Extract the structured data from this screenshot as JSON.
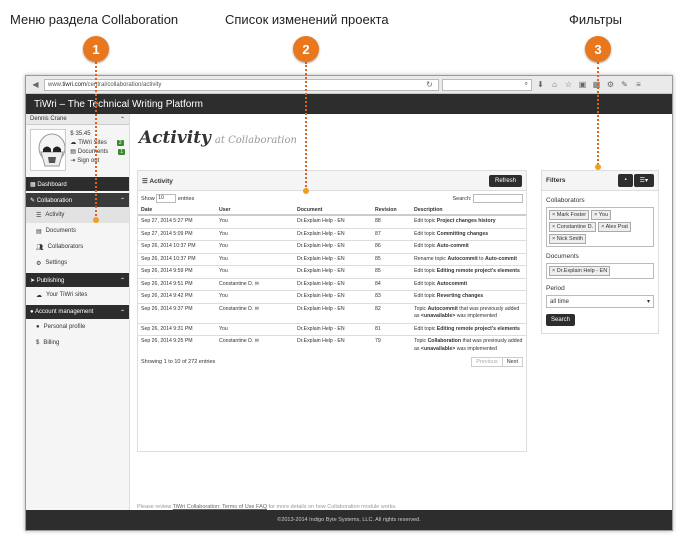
{
  "callouts": [
    {
      "label": "Меню раздела Collaboration",
      "number": "1"
    },
    {
      "label": "Список изменений проекта",
      "number": "2"
    },
    {
      "label": "Фильтры",
      "number": "3"
    }
  ],
  "browser": {
    "url_prefix": "www.",
    "url_domain": "tiwri.com",
    "url_path": "/central/collaboration/activity",
    "search_icon": "search-icon"
  },
  "app": {
    "title": "TiWri  – The Technical Writing Platform"
  },
  "sidebar": {
    "user_name": "Dennis Crane",
    "stats": [
      {
        "icon": "$",
        "label": "35.45",
        "count": ""
      },
      {
        "icon": "☁",
        "label": "TiWri Sites",
        "count": "2"
      },
      {
        "icon": "▤",
        "label": "Documents",
        "count": "1"
      },
      {
        "icon": "⇥",
        "label": "Sign out",
        "count": ""
      }
    ],
    "dashboard": "Dashboard",
    "collaboration": "Collaboration",
    "collab_items": [
      "Activity",
      "Documents",
      "Collaborators",
      "Settings"
    ],
    "publishing": "Publishing",
    "publishing_items": [
      "Your TiWri sites"
    ],
    "account": "Account management",
    "account_items": [
      "Personal profile",
      "Billing"
    ]
  },
  "page": {
    "title": "Activity",
    "subtitle": "at Collaboration"
  },
  "activity": {
    "panel_title": "Activity",
    "refresh": "Refresh",
    "show_label": "Show",
    "show_value": "10",
    "entries_label": "entries",
    "search_label": "Search:",
    "columns": [
      "Date",
      "User",
      "Document",
      "Revision",
      "Description"
    ],
    "rows": [
      {
        "date": "Sep 27, 2014 5:27 PM",
        "user": "You",
        "doc": "Dr.Explain Help - EN",
        "rev": "88",
        "pre": "Edit topic ",
        "bold": "Project changes history",
        "post": "",
        "bold2": "",
        "post2": ""
      },
      {
        "date": "Sep 27, 2014 5:09 PM",
        "user": "You",
        "doc": "Dr.Explain Help - EN",
        "rev": "87",
        "pre": "Edit topic ",
        "bold": "Committing changes",
        "post": "",
        "bold2": "",
        "post2": ""
      },
      {
        "date": "Sep 26, 2014 10:37 PM",
        "user": "You",
        "doc": "Dr.Explain Help - EN",
        "rev": "86",
        "pre": "Edit topic ",
        "bold": "Auto-commit",
        "post": "",
        "bold2": "",
        "post2": ""
      },
      {
        "date": "Sep 26, 2014 10:37 PM",
        "user": "You",
        "doc": "Dr.Explain Help - EN",
        "rev": "85",
        "pre": "Rename topic ",
        "bold": "Autocommit",
        "post": " to ",
        "bold2": "Auto-commit",
        "post2": ""
      },
      {
        "date": "Sep 26, 2014 9:59 PM",
        "user": "You",
        "doc": "Dr.Explain Help - EN",
        "rev": "85",
        "pre": "Edit topic ",
        "bold": "Editing remote project's elements",
        "post": "",
        "bold2": "",
        "post2": ""
      },
      {
        "date": "Sep 26, 2014 9:51 PM",
        "user": "Constantine D.",
        "doc": "Dr.Explain Help - EN",
        "rev": "84",
        "pre": "Edit topic ",
        "bold": "Autocommit",
        "post": "",
        "bold2": "",
        "post2": ""
      },
      {
        "date": "Sep 26, 2014 9:42 PM",
        "user": "You",
        "doc": "Dr.Explain Help - EN",
        "rev": "83",
        "pre": "Edit topic ",
        "bold": "Reverting changes",
        "post": "",
        "bold2": "",
        "post2": ""
      },
      {
        "date": "Sep 26, 2014 9:37 PM",
        "user": "Constantine D.",
        "doc": "Dr.Explain Help - EN",
        "rev": "82",
        "pre": "Topic ",
        "bold": "Autocommit",
        "post": " that was previously added as ",
        "bold2": "<unavailable>",
        "post2": " was implemented"
      },
      {
        "date": "Sep 26, 2014 9:31 PM",
        "user": "You",
        "doc": "Dr.Explain Help - EN",
        "rev": "81",
        "pre": "Edit topic ",
        "bold": "Editing remote project's elements",
        "post": "",
        "bold2": "",
        "post2": ""
      },
      {
        "date": "Sep 26, 2014 9:25 PM",
        "user": "Constantine D.",
        "doc": "Dr.Explain Help - EN",
        "rev": "79",
        "pre": "Topic ",
        "bold": "Collaboration",
        "post": " that was previously added as ",
        "bold2": "<unavailable>",
        "post2": " was implemented"
      }
    ],
    "info": "Showing 1 to 10 of 272 entries",
    "prev": "Previous",
    "next": "Next"
  },
  "filters": {
    "title": "Filters",
    "collab_label": "Collaborators",
    "collaborators": [
      "Mark Foster",
      "You",
      "Constantine D.",
      "Alex Prat",
      "Nick Smith"
    ],
    "docs_label": "Documents",
    "documents": [
      "Dr.Explain Help - EN"
    ],
    "period_label": "Period",
    "period_value": "all time",
    "search": "Search"
  },
  "note": {
    "pre": "Please review ",
    "link": "TiWri Collaboration: Terms of Use FAQ",
    "post": " for more details on how Collaboration module works."
  },
  "footer": "©2013-2014 Indigo Byte Systems, LLC. All rights reserved."
}
